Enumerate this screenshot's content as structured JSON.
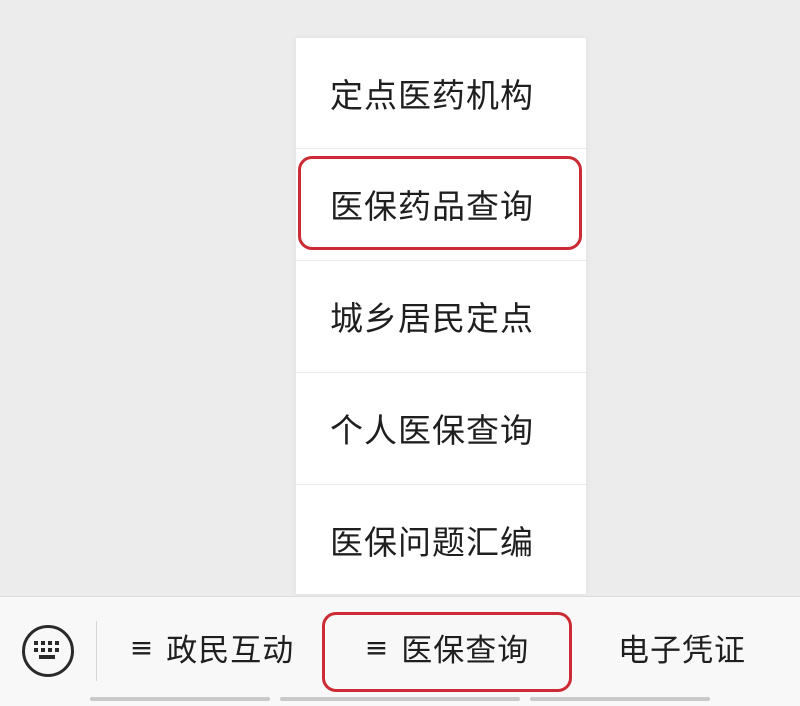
{
  "submenu": {
    "items": [
      {
        "label": "定点医药机构"
      },
      {
        "label": "医保药品查询"
      },
      {
        "label": "城乡居民定点"
      },
      {
        "label": "个人医保查询"
      },
      {
        "label": "医保问题汇编"
      }
    ],
    "highlighted_item": "医保药品查询"
  },
  "menu_bar": {
    "keyboard_icon": "keyboard-icon",
    "menu_glyph": "≡",
    "tabs": [
      {
        "label": "政民互动",
        "has_submenu": true
      },
      {
        "label": "医保查询",
        "has_submenu": true
      },
      {
        "label": "电子凭证",
        "has_submenu": false
      }
    ],
    "highlighted_tab": "医保查询"
  },
  "colors": {
    "highlight_border": "#cc2b35",
    "menu_background": "#ffffff",
    "page_background": "#ececec",
    "text": "#1f1f1f"
  }
}
